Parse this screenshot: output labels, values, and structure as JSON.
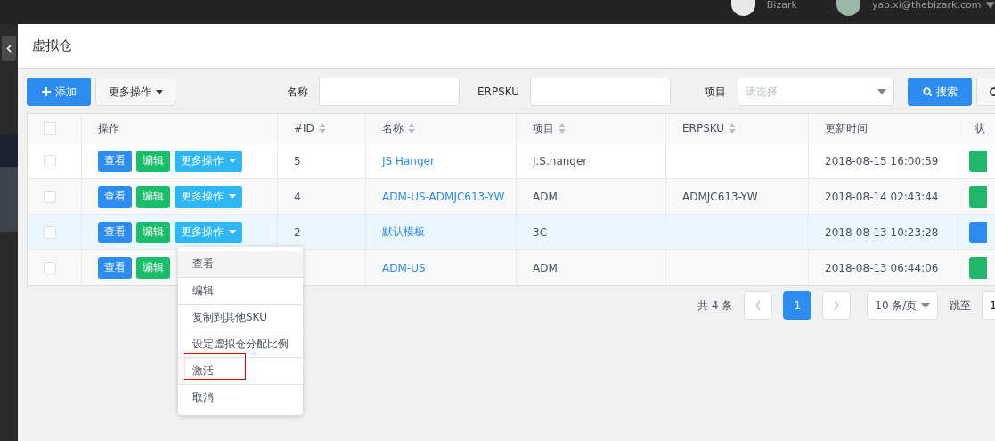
{
  "topbar": {
    "items": [
      {
        "kind": "avatar",
        "label": "Bizark"
      },
      {
        "kind": "user",
        "label": "yao.xi@thebizark.com"
      }
    ]
  },
  "page": {
    "title": "虚拟仓"
  },
  "toolbar": {
    "add_button": "添加",
    "more_button": "更多操作",
    "filters": [
      {
        "kind": "text",
        "label": "名称"
      },
      {
        "kind": "text",
        "label": "ERPSKU"
      },
      {
        "kind": "select",
        "label": "项目",
        "placeholder": "请选择"
      }
    ],
    "search_button": "搜索"
  },
  "table": {
    "select_all_checked": false,
    "columns": [
      {
        "label": "操作",
        "sortable": false
      },
      {
        "label": "#ID",
        "sortable": true
      },
      {
        "label": "名称",
        "sortable": true
      },
      {
        "label": "项目",
        "sortable": true
      },
      {
        "label": "ERPSKU",
        "sortable": true
      },
      {
        "label": "更新时间",
        "sortable": false
      },
      {
        "label": "状",
        "sortable": false
      }
    ],
    "rows": [
      {
        "checked": false,
        "highlighted": false,
        "actions": [
          {
            "kind": "view",
            "label": "查看"
          },
          {
            "kind": "edit",
            "label": "编辑"
          },
          {
            "kind": "more",
            "label": "更多操作"
          }
        ],
        "id": "5",
        "name": "JS Hanger",
        "project": "J.S.hanger",
        "updated": "2018-08-15 16:00:59",
        "color": "#1fb868"
      },
      {
        "checked": false,
        "highlighted": false,
        "actions": [
          {
            "kind": "view",
            "label": "查看"
          },
          {
            "kind": "edit",
            "label": "编辑"
          },
          {
            "kind": "more",
            "label": "更多操作"
          }
        ],
        "id": "4",
        "name": "ADM-US-ADMJC613-YW",
        "project": "ADM",
        "erpsku": "ADMJC613-YW",
        "updated": "2018-08-14 02:43:44",
        "color": "#1fb868"
      },
      {
        "checked": false,
        "highlighted": true,
        "actions": [
          {
            "kind": "view",
            "label": "查看"
          },
          {
            "kind": "edit",
            "label": "编辑"
          },
          {
            "kind": "more",
            "label": "更多操作"
          }
        ],
        "id": "2",
        "name": "默认模板",
        "project": "3C",
        "updated": "2018-08-13 10:23:28",
        "color": "#2d8cf0"
      },
      {
        "checked": false,
        "highlighted": false,
        "actions": [
          {
            "kind": "view",
            "label": "查看"
          },
          {
            "kind": "edit",
            "label": "编辑"
          }
        ],
        "name": "ADM-US",
        "project": "ADM",
        "updated": "2018-08-13 06:44:06",
        "color": "#1fb868"
      }
    ]
  },
  "dropdown_menu": {
    "items": [
      {
        "label": "查看",
        "hovered": true,
        "marked": false
      },
      {
        "label": "编辑",
        "hovered": false,
        "marked": false
      },
      {
        "label": "复制到其他SKU",
        "hovered": false,
        "marked": false
      },
      {
        "label": "设定虚拟仓分配比例",
        "hovered": false,
        "marked": false
      },
      {
        "label": "激活",
        "hovered": false,
        "marked": true
      },
      {
        "label": "取消",
        "hovered": false,
        "marked": false
      }
    ]
  },
  "pagination": {
    "total": "共 4 条",
    "pages": [
      {
        "label": "1",
        "selected": true
      }
    ],
    "page_size": "10 条/页",
    "jump_label": "跳至",
    "jump_value": "1"
  }
}
